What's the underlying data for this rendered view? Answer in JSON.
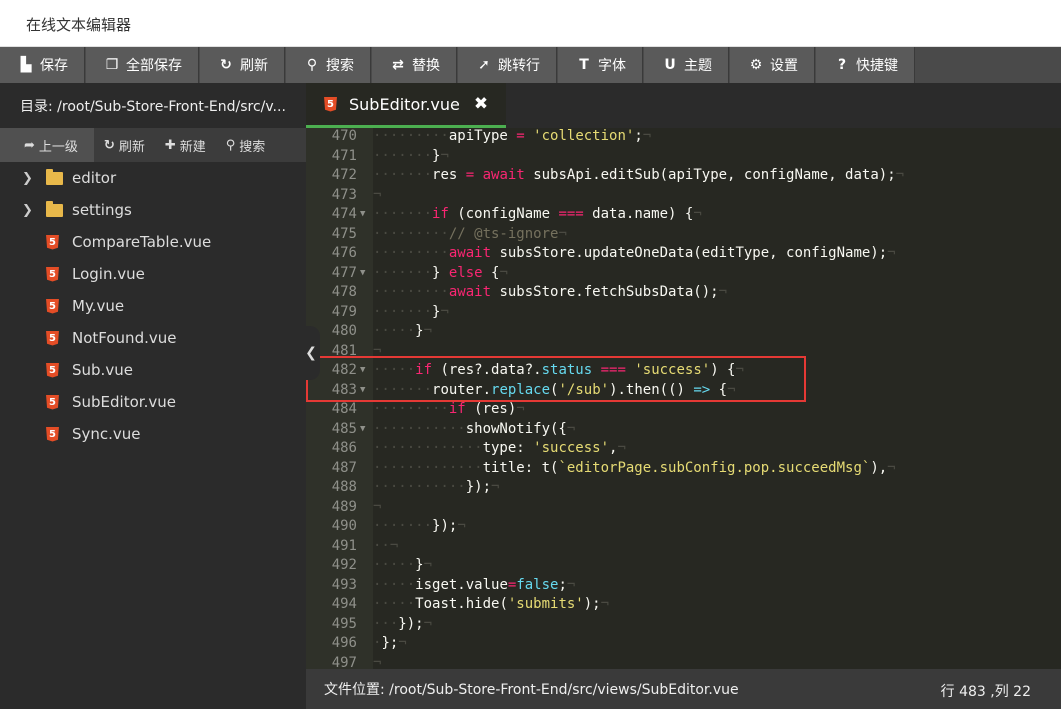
{
  "app": {
    "title": "在线文本编辑器"
  },
  "toolbar": [
    {
      "icon": "save-icon",
      "glyph": "▙",
      "label": "保存"
    },
    {
      "icon": "save-all-icon",
      "glyph": "❐",
      "label": "全部保存"
    },
    {
      "icon": "refresh-icon",
      "glyph": "↻",
      "label": "刷新"
    },
    {
      "icon": "search-icon",
      "glyph": "⚲",
      "label": "搜索"
    },
    {
      "icon": "replace-icon",
      "glyph": "⇄",
      "label": "替换"
    },
    {
      "icon": "goto-line-icon",
      "glyph": "➚",
      "label": "跳转行"
    },
    {
      "icon": "font-icon",
      "glyph": "T",
      "label": "字体"
    },
    {
      "icon": "theme-icon",
      "glyph": "U",
      "label": "主题"
    },
    {
      "icon": "settings-icon",
      "glyph": "⚙",
      "label": "设置"
    },
    {
      "icon": "shortcut-icon",
      "glyph": "?",
      "label": "快捷键"
    }
  ],
  "sidebar": {
    "directory": "目录: /root/Sub-Store-Front-End/src/v...",
    "tools": [
      {
        "icon": "up-arrow-icon",
        "glyph": "➦",
        "label": "上一级"
      },
      {
        "icon": "refresh-icon",
        "glyph": "↻",
        "label": "刷新"
      },
      {
        "icon": "plus-icon",
        "glyph": "✚",
        "label": "新建"
      },
      {
        "icon": "search-icon",
        "glyph": "⚲",
        "label": "搜索"
      }
    ],
    "folders": [
      {
        "name": "editor"
      },
      {
        "name": "settings"
      }
    ],
    "files": [
      {
        "name": "CompareTable.vue"
      },
      {
        "name": "Login.vue"
      },
      {
        "name": "My.vue"
      },
      {
        "name": "NotFound.vue"
      },
      {
        "name": "Sub.vue"
      },
      {
        "name": "SubEditor.vue"
      },
      {
        "name": "Sync.vue"
      }
    ]
  },
  "editor": {
    "tab_label": "SubEditor.vue",
    "lines": [
      {
        "n": "470",
        "fold": false,
        "html": "<span class=\"ws\">·········</span>apiType <span class=\"op\">=</span> <span class=\"str\">'collection'</span>;<span class=\"ws\">¬</span>"
      },
      {
        "n": "471",
        "fold": false,
        "html": "<span class=\"ws\">·······</span>}<span class=\"ws\">¬</span>"
      },
      {
        "n": "472",
        "fold": false,
        "html": "<span class=\"ws\">·······</span>res <span class=\"op\">=</span> <span class=\"kw\">await</span> subsApi.editSub(apiType, configName, data);<span class=\"ws\">¬</span>"
      },
      {
        "n": "473",
        "fold": false,
        "html": "<span class=\"ws\">¬</span>"
      },
      {
        "n": "474",
        "fold": true,
        "html": "<span class=\"ws\">·······</span><span class=\"kw\">if</span> (configName <span class=\"op\">===</span> data.name) {<span class=\"ws\">¬</span>"
      },
      {
        "n": "475",
        "fold": false,
        "html": "<span class=\"ws\">·········</span><span class=\"cm\">// @ts-ignore</span><span class=\"ws\">¬</span>"
      },
      {
        "n": "476",
        "fold": false,
        "html": "<span class=\"ws\">·········</span><span class=\"kw\">await</span> subsStore.updateOneData(editType, configName);<span class=\"ws\">¬</span>"
      },
      {
        "n": "477",
        "fold": true,
        "html": "<span class=\"ws\">·······</span>} <span class=\"kw\">else</span> {<span class=\"ws\">¬</span>"
      },
      {
        "n": "478",
        "fold": false,
        "html": "<span class=\"ws\">·········</span><span class=\"kw\">await</span> subsStore.fetchSubsData();<span class=\"ws\">¬</span>"
      },
      {
        "n": "479",
        "fold": false,
        "html": "<span class=\"ws\">·······</span>}<span class=\"ws\">¬</span>"
      },
      {
        "n": "480",
        "fold": false,
        "html": "<span class=\"ws\">·····</span>}<span class=\"ws\">¬</span>"
      },
      {
        "n": "481",
        "fold": false,
        "html": "<span class=\"ws\">¬</span>"
      },
      {
        "n": "482",
        "fold": true,
        "html": "<span class=\"ws\">·····</span><span class=\"kw\">if</span> (res?.data?.<span class=\"blue\">status</span> <span class=\"op\">===</span> <span class=\"str\">'success'</span>) {<span class=\"ws\">¬</span>"
      },
      {
        "n": "483",
        "fold": true,
        "html": "<span class=\"ws\">·······</span>router.<span class=\"blue\">replace</span>(<span class=\"str\">'/sub'</span>).then(() <span class=\"blue\">=&gt;</span> {<span class=\"ws\">¬</span>"
      },
      {
        "n": "484",
        "fold": false,
        "html": "<span class=\"ws\">·········</span><span class=\"kw\">if</span> (res)<span class=\"ws\">¬</span>"
      },
      {
        "n": "485",
        "fold": true,
        "html": "<span class=\"ws\">···········</span>showNotify({<span class=\"ws\">¬</span>"
      },
      {
        "n": "486",
        "fold": false,
        "html": "<span class=\"ws\">·············</span>type: <span class=\"str\">'success'</span>,<span class=\"ws\">¬</span>"
      },
      {
        "n": "487",
        "fold": false,
        "html": "<span class=\"ws\">·············</span>title: t(<span class=\"str\">`editorPage.subConfig.pop.succeedMsg`</span>),<span class=\"ws\">¬</span>"
      },
      {
        "n": "488",
        "fold": false,
        "html": "<span class=\"ws\">···········</span>});<span class=\"ws\">¬</span>"
      },
      {
        "n": "489",
        "fold": false,
        "html": "<span class=\"ws\">¬</span>"
      },
      {
        "n": "490",
        "fold": false,
        "html": "<span class=\"ws\">·······</span>});<span class=\"ws\">¬</span>"
      },
      {
        "n": "491",
        "fold": false,
        "html": "<span class=\"ws\">··¬</span>"
      },
      {
        "n": "492",
        "fold": false,
        "html": "<span class=\"ws\">·····</span>}<span class=\"ws\">¬</span>"
      },
      {
        "n": "493",
        "fold": false,
        "html": "<span class=\"ws\">·····</span>isget.value<span class=\"op\">=</span><span class=\"blue\">false</span>;<span class=\"ws\">¬</span>"
      },
      {
        "n": "494",
        "fold": false,
        "html": "<span class=\"ws\">·····</span>Toast.hide(<span class=\"str\">'submits'</span>);<span class=\"ws\">¬</span>"
      },
      {
        "n": "495",
        "fold": false,
        "html": "<span class=\"ws\">···</span>});<span class=\"ws\">¬</span>"
      },
      {
        "n": "496",
        "fold": false,
        "html": "<span class=\"ws\">·</span>};<span class=\"ws\">¬</span>"
      },
      {
        "n": "497",
        "fold": false,
        "html": "<span class=\"ws\">¬</span>"
      }
    ]
  },
  "status": {
    "file_path": "文件位置: /root/Sub-Store-Front-End/src/views/SubEditor.vue",
    "cursor": "行 483 ,列 22"
  },
  "colors": {
    "accent": "#4caf50",
    "highlight_box": "#e53935",
    "vue_icon": "#e44d26",
    "folder": "#e8b84a"
  }
}
